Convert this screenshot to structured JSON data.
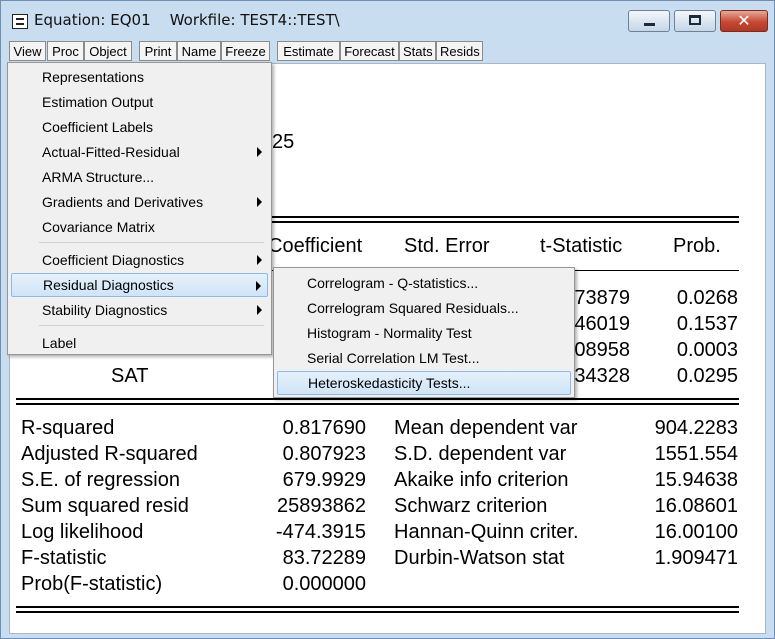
{
  "window": {
    "title": "Equation: EQ01    Workfile: TEST4::TEST\\",
    "controls": {
      "minimize": "minimize-icon",
      "maximize": "maximize-icon",
      "close": "✕"
    }
  },
  "toolbar": [
    "View",
    "Proc",
    "Object",
    "Print",
    "Name",
    "Freeze",
    "Estimate",
    "Forecast",
    "Stats",
    "Resids"
  ],
  "view_menu": {
    "items": [
      {
        "label": "Representations"
      },
      {
        "label": "Estimation Output"
      },
      {
        "label": "Coefficient Labels"
      },
      {
        "label": "Actual-Fitted-Residual",
        "submenu": true
      },
      {
        "label": "ARMA Structure..."
      },
      {
        "label": "Gradients and Derivatives",
        "submenu": true
      },
      {
        "label": "Covariance Matrix"
      },
      {
        "label": "Coefficient Diagnostics",
        "submenu": true
      },
      {
        "label": "Residual Diagnostics",
        "submenu": true,
        "highlighted": true
      },
      {
        "label": "Stability Diagnostics",
        "submenu": true
      },
      {
        "label": "Label"
      }
    ]
  },
  "residual_submenu": {
    "items": [
      {
        "label": "Correlogram - Q-statistics..."
      },
      {
        "label": "Correlogram Squared Residuals..."
      },
      {
        "label": "Histogram - Normality Test"
      },
      {
        "label": "Serial Correlation LM Test..."
      },
      {
        "label": "Heteroskedasticity Tests...",
        "highlighted": true
      }
    ]
  },
  "output": {
    "partial_header": "25",
    "columns": {
      "coefficient": "Coefficient",
      "std_error": "Std. Error",
      "t_statistic": "t-Statistic",
      "prob": "Prob."
    },
    "rows": [
      {
        "variable": "",
        "t_stat_partial": "73879",
        "prob": "0.0268"
      },
      {
        "variable": "",
        "t_stat_partial": "46019",
        "prob": "0.1537"
      },
      {
        "variable": "",
        "t_stat_partial": "08958",
        "prob": "0.0003"
      },
      {
        "variable": "SAT",
        "t_stat_partial": "34328",
        "prob": "0.0295"
      }
    ],
    "stats_left": [
      {
        "label": "R-squared",
        "value": "0.817690"
      },
      {
        "label": "Adjusted R-squared",
        "value": "0.807923"
      },
      {
        "label": "S.E. of regression",
        "value": "679.9929"
      },
      {
        "label": "Sum squared resid",
        "value": "25893862"
      },
      {
        "label": "Log likelihood",
        "value": "-474.3915"
      },
      {
        "label": "F-statistic",
        "value": "83.72289"
      },
      {
        "label": "Prob(F-statistic)",
        "value": "0.000000"
      }
    ],
    "stats_right": [
      {
        "label": "Mean dependent var",
        "value": "904.2283"
      },
      {
        "label": "S.D. dependent var",
        "value": "1551.554"
      },
      {
        "label": "Akaike info criterion",
        "value": "15.94638"
      },
      {
        "label": "Schwarz criterion",
        "value": "16.08601"
      },
      {
        "label": "Hannan-Quinn criter.",
        "value": "16.00100"
      },
      {
        "label": "Durbin-Watson stat",
        "value": "1.909471"
      }
    ]
  }
}
